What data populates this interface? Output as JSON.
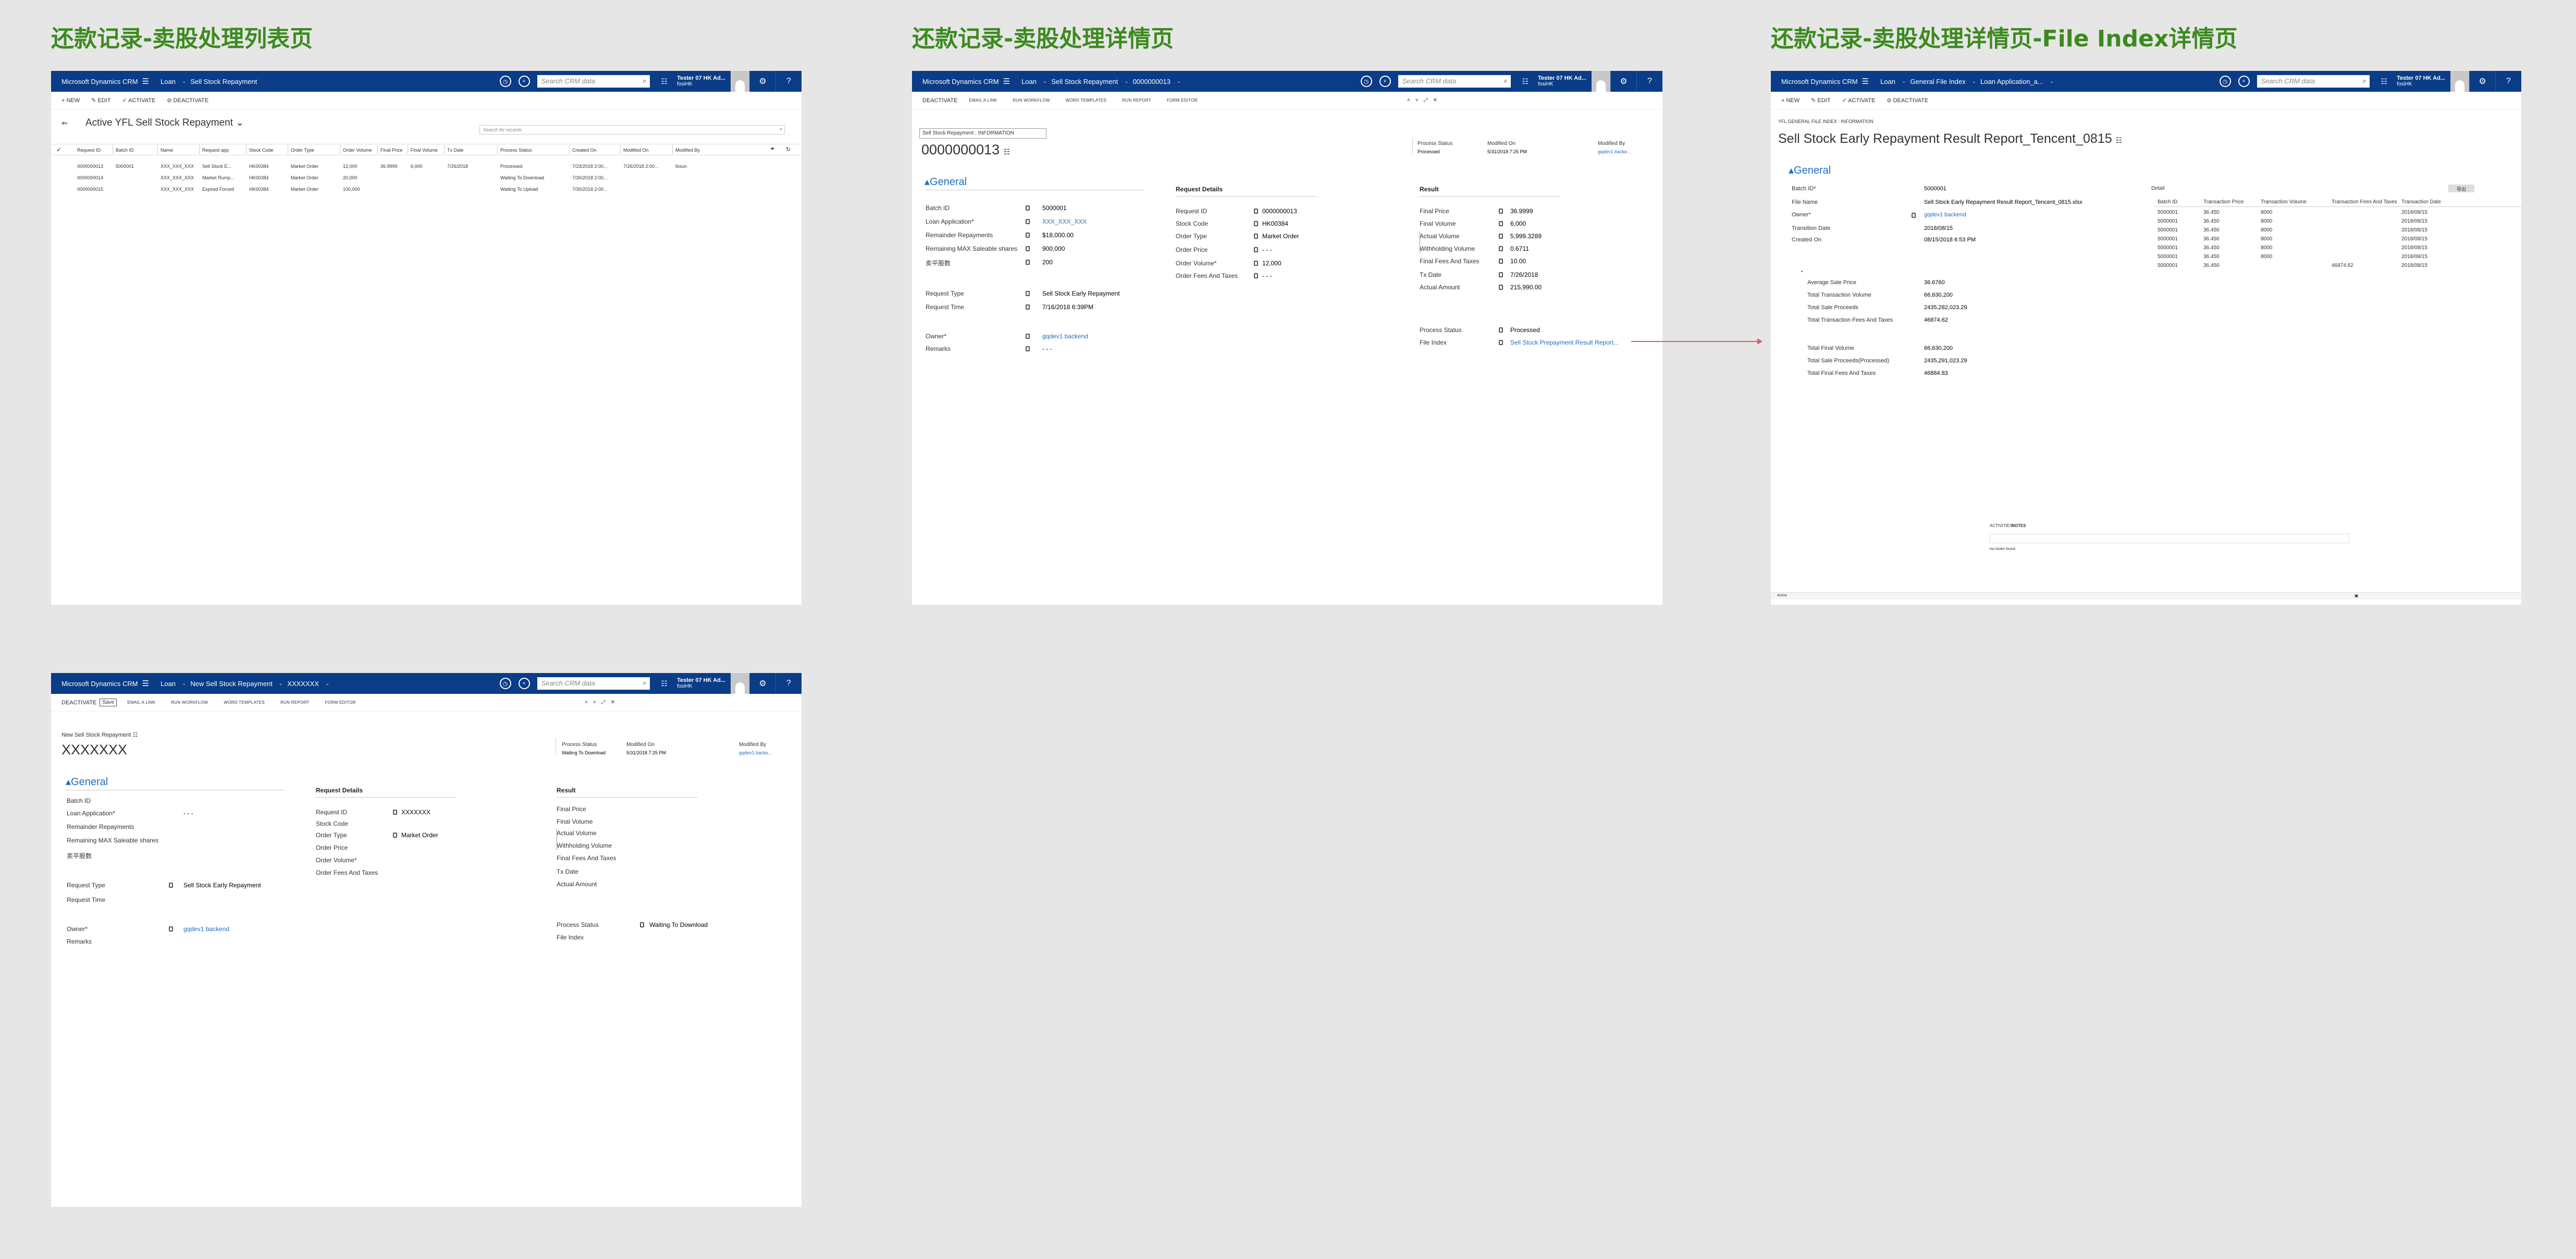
{
  "titles": {
    "list": "还款记录-卖股处理列表页",
    "detail": "还款记录-卖股处理详情页",
    "file_index": "还款记录-卖股处理详情页-File Index详情页"
  },
  "nav": {
    "brand": "Microsoft Dynamics CRM",
    "module": "Loan",
    "search_placeholder": "Search CRM data",
    "user_name": "Tester 07 HK Ad...",
    "user_org": "fosiHK"
  },
  "list_page": {
    "entity": "Sell Stock Repayment",
    "commands": [
      "+ NEW",
      "✎ EDIT",
      "✓ ACTIVATE",
      "⊘ DEACTIVATE"
    ],
    "view_title": "Active YFL Sell Stock Repayment",
    "search_placeholder": "Search for records",
    "columns": [
      "Request ID",
      "Batch ID",
      "Name",
      "Request app",
      "Stock Code",
      "Order Type",
      "Order Volume",
      "Final Price",
      "Final Volume",
      "Tx Date",
      "Process Status",
      "Created On",
      "Modified On",
      "Modified By"
    ],
    "rows": [
      [
        "0000000013",
        "5000001",
        "XXX_XXX_XXX",
        "Sell Stock E...",
        "HK00384",
        "Market Order",
        "12,000",
        "36.9999",
        "6,000",
        "7/26/2018",
        "Processed",
        "7/23/2018 2:00...",
        "7/26/2018 2:00...",
        "fosun"
      ],
      [
        "0000000014",
        "",
        "XXX_XXX_XXX",
        "Market Rump...",
        "HK00384",
        "Market Order",
        "20,000",
        "",
        "",
        "",
        "Waiting To Download",
        "7/30/2018 2:00...",
        "",
        ""
      ],
      [
        "0000000015",
        "",
        "XXX_XXX_XXX",
        "Expired Forced",
        "HK00384",
        "Market Order",
        "100,000",
        "",
        "",
        "",
        "Waiting To Upload",
        "7/30/2018 2:00...",
        "",
        ""
      ]
    ]
  },
  "detail_page": {
    "entity": "Sell Stock Repayment",
    "record": "0000000013",
    "commands": [
      "DEACTIVATE",
      "EMAIL A LINK",
      "RUN WORKFLOW",
      "WORD TEMPLATES",
      "RUN REPORT",
      "FORM EDITOR"
    ],
    "form_selector": "Sell Stock Repayment : INFORMATION",
    "title": "0000000013",
    "process_status_label": "Process Status",
    "process_status_value": "Processed",
    "modified_on_label": "Modified On",
    "modified_on_value": "5/31/2018  7:25 PM",
    "modified_by_label": "Modified By",
    "modified_by_value": "gqdev1 backe...",
    "general": "General",
    "left_fields": [
      {
        "label": "Batch ID",
        "value": "5000001"
      },
      {
        "label": "Loan Application*",
        "value": "XXX_XXX_XXX"
      },
      {
        "label": "Remainder Repayments",
        "value": "$18,000.00"
      },
      {
        "label": "Remaining MAX Saleable shares",
        "value": "900,000"
      },
      {
        "label": "卖平股数",
        "value": "200"
      },
      {
        "label": "Request Type",
        "value": "Sell Stock Early Repayment"
      },
      {
        "label": "Request Time",
        "value": "7/16/2018  6:39PM"
      },
      {
        "label": "Owner*",
        "value": "gqdev1 backend"
      },
      {
        "label": "Remarks",
        "value": "- - -"
      }
    ],
    "request_details": "Request Details",
    "mid_fields": [
      {
        "label": "Request ID",
        "value": "0000000013"
      },
      {
        "label": "Stock Code",
        "value": "HK00384"
      },
      {
        "label": "Order Type",
        "value": "Market Order"
      },
      {
        "label": "Order Price",
        "value": "- - -"
      },
      {
        "label": "Order Volume*",
        "value": "12,000"
      },
      {
        "label": "Order Fees And Taxes",
        "value": "- - -"
      }
    ],
    "result": "Result",
    "right_fields": [
      {
        "label": "Final Price",
        "value": "36.9999"
      },
      {
        "label": "Final Volume",
        "value": "6,000"
      },
      {
        "label": "Actual Volume",
        "value": "5,999.3289"
      },
      {
        "label": "Withholding Volume",
        "value": "0.6711"
      },
      {
        "label": "Final Fees And Taxes",
        "value": "10.00"
      },
      {
        "label": "Tx Date",
        "value": "7/26/2018"
      },
      {
        "label": "Actual Amount",
        "value": "215,990.00"
      },
      {
        "label": "Process Status",
        "value": "Processed"
      },
      {
        "label": "File Index",
        "value": "Sell Stock Prepayment Result Report..."
      }
    ]
  },
  "file_page": {
    "entity": "General File Index",
    "record": "Loan Application_a...",
    "commands": [
      "+ NEW",
      "✎ EDIT",
      "✓ ACTIVATE",
      "⊘ DEACTIVATE"
    ],
    "breadcrumb": "YFL GENERAL FILE INDEX : INFORMATION",
    "title": "Sell Stock Early Repayment Result Report_Tencent_0815",
    "general": "General",
    "fields": [
      {
        "label": "Batch ID*",
        "value": "5000001"
      },
      {
        "label": "File Name",
        "value": "Sell Stock Early Repayment Result Report_Tencent_0815.xlsx"
      },
      {
        "label": "Owner*",
        "value": "gqdev1 backend"
      },
      {
        "label": "Transition Date",
        "value": "2018/08/15"
      },
      {
        "label": "Created On",
        "value": "08/15/2018  6:53 PM"
      }
    ],
    "detail_label": "Detail",
    "export_label": "导出",
    "detail_columns": [
      "Batch ID",
      "Transaction Price",
      "Transaction Volume",
      "Transaction Fees And Taxes",
      "Transaction Date"
    ],
    "detail_rows": [
      [
        "5000001",
        "36.450",
        "8000",
        "",
        "2018/08/15"
      ],
      [
        "5000001",
        "36.450",
        "8000",
        "",
        "2018/08/15"
      ],
      [
        "5000001",
        "36.450",
        "8000",
        "",
        "2018/08/15"
      ],
      [
        "5000001",
        "36.450",
        "8000",
        "",
        "2018/08/15"
      ],
      [
        "5000001",
        "36.450",
        "8000",
        "",
        "2018/08/15"
      ],
      [
        "5000001",
        "36.450",
        "8000",
        "",
        "2018/08/15"
      ],
      [
        "5000001",
        "36.450",
        "",
        "46874.62",
        "2018/08/15"
      ]
    ],
    "summary": [
      {
        "label": "Average Sale Price",
        "value": "36.6760"
      },
      {
        "label": "Total Transaction Volume",
        "value": "66,630,200"
      },
      {
        "label": "Total Sale Proceeds",
        "value": "2435,282,023.29"
      },
      {
        "label": "Total Transaction Fees And Taxes",
        "value": "46874.62"
      }
    ],
    "summary2": [
      {
        "label": "Total Final Volume",
        "value": "66,630,200"
      },
      {
        "label": "Total Sale Proceeds(Processed)",
        "value": "2435,291,023.29"
      },
      {
        "label": "Total Final Fees And Taxes",
        "value": "46884.83"
      }
    ],
    "tabs": [
      "ACTIVITIES",
      "NOTES"
    ],
    "no_notes": "No Notes found.",
    "status": "Active"
  },
  "new_page": {
    "entity": "New Sell Stock Repayment",
    "record": "XXXXXXX",
    "commands": [
      "DEACTIVATE",
      "Save",
      "EMAIL A LINK",
      "RUN WORKFLOW",
      "WORD TEMPLATES",
      "RUN REPORT",
      "FORM EDITOR"
    ],
    "form_selector": "New Sell Stock Repayment",
    "title": "XXXXXXX",
    "process_status_label": "Process Status",
    "process_status_value": "Waiting To Download",
    "modified_on_label": "Modified On",
    "modified_on_value": "5/31/2018  7:25 PM",
    "modified_by_label": "Modified By",
    "modified_by_value": "gqdev1 backe...",
    "general": "General",
    "left_fields": [
      {
        "label": "Batch ID",
        "value": ""
      },
      {
        "label": "Loan Application*",
        "value": "- - -"
      },
      {
        "label": "Remainder Repayments",
        "value": ""
      },
      {
        "label": "Remaining MAX Saleable shares",
        "value": ""
      },
      {
        "label": "卖平股数",
        "value": ""
      },
      {
        "label": "Request Type",
        "value": "Sell Stock Early Repayment"
      },
      {
        "label": "Request Time",
        "value": ""
      },
      {
        "label": "Owner*",
        "value": "gqdev1 backend"
      },
      {
        "label": "Remarks",
        "value": ""
      }
    ],
    "request_details": "Request Details",
    "mid_fields": [
      {
        "label": "Request ID",
        "value": "XXXXXXX"
      },
      {
        "label": "Stock Code",
        "value": ""
      },
      {
        "label": "Order Type",
        "value": "Market Order"
      },
      {
        "label": "Order Price",
        "value": ""
      },
      {
        "label": "Order Volume*",
        "value": ""
      },
      {
        "label": "Order Fees And Taxes",
        "value": ""
      }
    ],
    "result": "Result",
    "right_fields": [
      {
        "label": "Final Price",
        "value": ""
      },
      {
        "label": "Final Volume",
        "value": ""
      },
      {
        "label": "Actual Volume",
        "value": ""
      },
      {
        "label": "Withholding Volume",
        "value": ""
      },
      {
        "label": "Final Fees And Taxes",
        "value": ""
      },
      {
        "label": "Tx Date",
        "value": ""
      },
      {
        "label": "Actual Amount",
        "value": ""
      },
      {
        "label": "Process Status",
        "value": "Waiting To Download"
      },
      {
        "label": "File Index",
        "value": ""
      }
    ]
  }
}
